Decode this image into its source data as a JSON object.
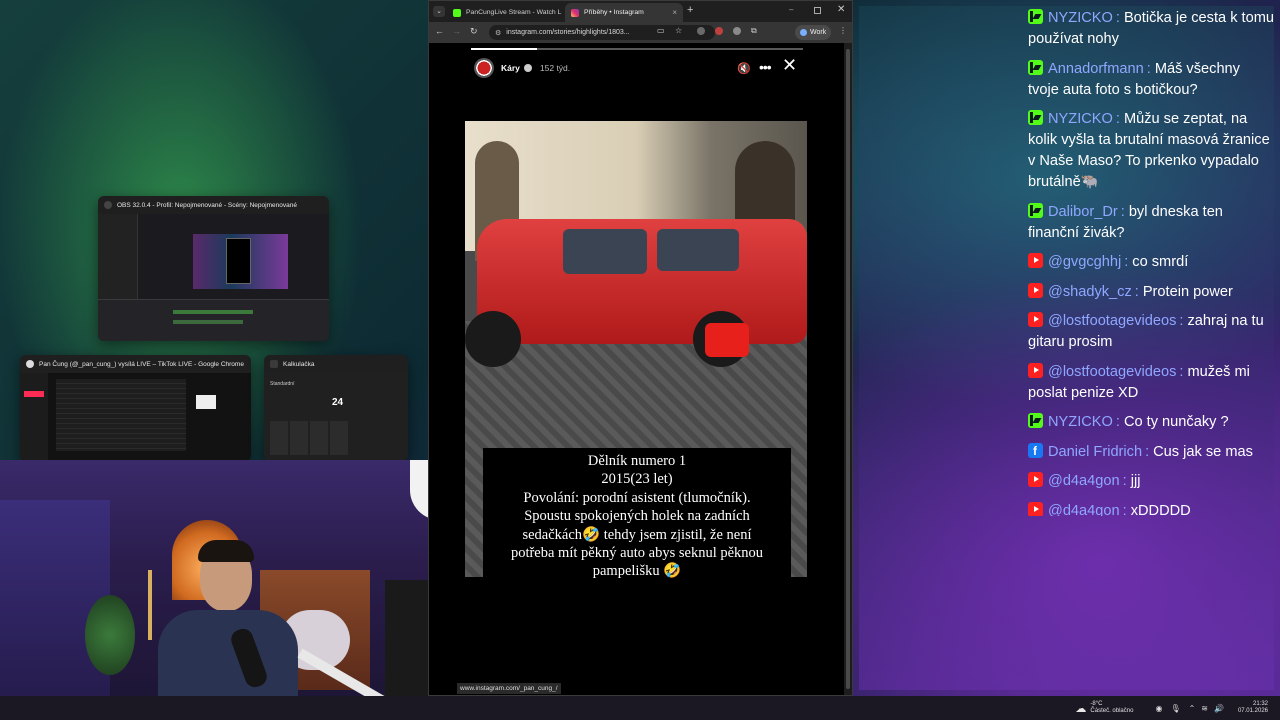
{
  "switcher": {
    "obs_title": "OBS 32.0.4 - Profil: Nepojmenované - Scény: Nepojmenované",
    "tiktok_title": "Pan Čung (@_pan_cung_) vysílá LIVE – TikTok LIVE - Google Chrome",
    "calc_title": "Kalkulačka",
    "calc_mode": "Standardní",
    "calc_display": "24"
  },
  "browser": {
    "tabs": [
      {
        "label": "PanCungLive Stream - Watch L"
      },
      {
        "label": "Příběhy • Instagram"
      }
    ],
    "new_tab": "+",
    "url": "instagram.com/stories/highlights/1803...",
    "profile_label": "Work",
    "status_url": "www.instagram.com/_pan_cung_/"
  },
  "story": {
    "account": "Káry",
    "age": "152 týd.",
    "caption_lines": [
      "Dělník numero 1",
      "2015(23 let)",
      "Povolání: porodní asistent (tlumočník).",
      "Spoustu spokojených holek na zadních",
      "sedačkách🤣 tehdy jsem zjistil, že není",
      "potřeba mít pěkný auto abys seknul pěknou",
      "pampelišku 🤣"
    ]
  },
  "chat": {
    "messages": [
      {
        "platform": "kick",
        "user": "NYZICKO",
        "text": "Botička je cesta k tomu používat nohy",
        "user_color": "#8fa7ff"
      },
      {
        "platform": "kick",
        "user": "Annadorfmann",
        "text": "Máš všechny tvoje auta foto s botičkou?",
        "user_color": "#8fa7ff"
      },
      {
        "platform": "kick",
        "user": "NYZICKO",
        "text": "Můžu se zeptat, na kolik vyšla ta brutalní masová žranice v Naše Maso? To prkenko vypadalo brutálně🐃",
        "user_color": "#8fa7ff"
      },
      {
        "platform": "kick",
        "user": "Dalibor_Dr",
        "text": "byl dneska ten finanční živák?",
        "user_color": "#8fa7ff"
      },
      {
        "platform": "youtube",
        "user": "@gvgcghhj",
        "text": "co smrdí",
        "user_color": "#8fa7ff"
      },
      {
        "platform": "youtube",
        "user": "@shadyk_cz",
        "text": "Protein power",
        "user_color": "#8fa7ff"
      },
      {
        "platform": "youtube",
        "user": "@lostfootagevideos",
        "text": "zahraj na tu gitaru prosim",
        "user_color": "#8fa7ff"
      },
      {
        "platform": "youtube",
        "user": "@lostfootagevideos",
        "text": "mužeš mi poslat penize XD",
        "user_color": "#8fa7ff"
      },
      {
        "platform": "kick",
        "user": "NYZICKO",
        "text": "Co ty nunčaky ?",
        "user_color": "#8fa7ff"
      },
      {
        "platform": "facebook",
        "user": "Daniel Fridrich",
        "text": "Cus jak se mas",
        "user_color": "#8fa7ff"
      },
      {
        "platform": "youtube",
        "user": "@d4a4gon",
        "text": "jjj",
        "user_color": "#8fa7ff"
      },
      {
        "platform": "youtube",
        "user": "@d4a4gon",
        "text": "xDDDDD",
        "user_color": "#8fa7ff"
      }
    ],
    "separator": ":"
  },
  "taskbar": {
    "temperature": "-8°C",
    "weather": "Částeč. oblačno",
    "time": "21:32",
    "date": "07.01.2026"
  },
  "colors": {
    "kick": "#53fc18",
    "youtube": "#ff2020",
    "facebook": "#1877f2",
    "username": "#8fa7ff"
  }
}
